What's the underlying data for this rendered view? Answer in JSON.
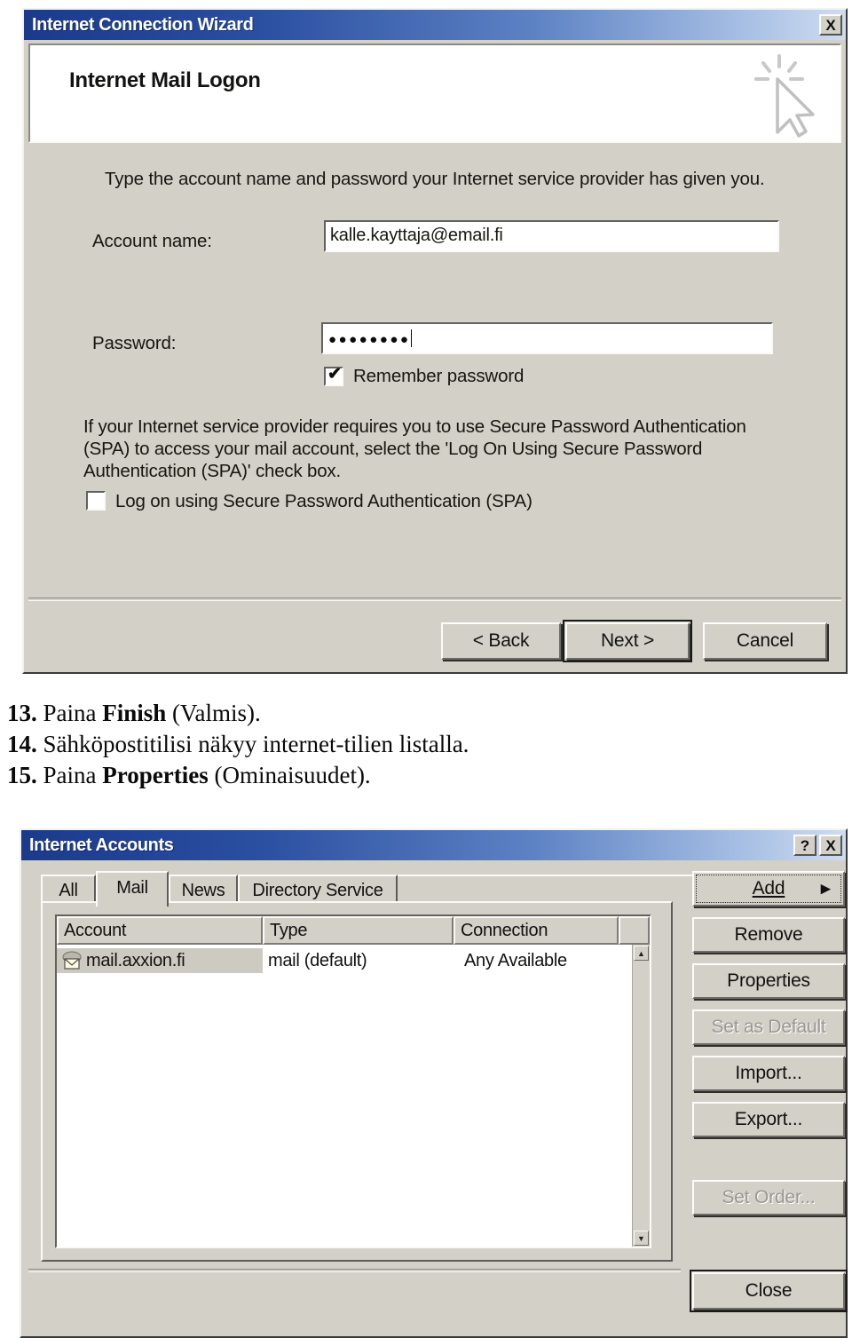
{
  "wizard": {
    "window_title": "Internet Connection Wizard",
    "close_button": "X",
    "heading": "Internet Mail Logon",
    "cursor_icon": "mouse-click-cursor-icon",
    "intro": "Type the account name and password your Internet service provider has given you.",
    "account_label": "Account name:",
    "account_value": "kalle.kayttaja@email.fi",
    "account_placeholder": "",
    "password_label": "Password:",
    "password_value": "●●●●●●●●",
    "password_placeholder": "",
    "remember_label": "Remember password",
    "remember_checked": true,
    "remember_tick": "✔",
    "spa_paragraph": "If your Internet service provider requires you to use Secure Password Authentication (SPA) to access your mail account, select the 'Log On Using Secure Password Authentication (SPA)' check box.",
    "spa_label": "Log on using Secure Password Authentication (SPA)",
    "spa_checked": false,
    "buttons": {
      "back": "< Back",
      "next": "Next >",
      "cancel": "Cancel"
    }
  },
  "steps": [
    {
      "number": "13.",
      "pre": "Paina ",
      "bold": "Finish",
      "post": " (Valmis)."
    },
    {
      "number": "14.",
      "pre": "Sähköpostitilisi näkyy internet-tilien listalla.",
      "bold": "",
      "post": ""
    },
    {
      "number": "15.",
      "pre": "Paina ",
      "bold": "Properties",
      "post": " (Ominaisuudet)."
    }
  ],
  "accounts": {
    "window_title": "Internet Accounts",
    "help_button": "?",
    "close_button": "X",
    "tabs": [
      {
        "label": "All",
        "selected": false
      },
      {
        "label": "Mail",
        "selected": true
      },
      {
        "label": "News",
        "selected": false
      },
      {
        "label": "Directory Service",
        "selected": false
      }
    ],
    "columns": [
      "Account",
      "Type",
      "Connection"
    ],
    "rows": [
      {
        "icon": "mail-account-icon",
        "account": "mail.axxion.fi",
        "type": "mail (default)",
        "connection": "Any Available",
        "selected": true
      }
    ],
    "scrollbar": {
      "up": "▲",
      "down": "▼"
    },
    "buttons": [
      {
        "label": "Add",
        "accel": "A",
        "arrow": "▶",
        "enabled": true,
        "focused": true
      },
      {
        "label": "Remove",
        "accel": "",
        "arrow": "",
        "enabled": true,
        "focused": false
      },
      {
        "label": "Properties",
        "accel": "",
        "arrow": "",
        "enabled": true,
        "focused": false
      },
      {
        "label": "Set as Default",
        "accel": "",
        "arrow": "",
        "enabled": false,
        "focused": false
      },
      {
        "label": "Import...",
        "accel": "",
        "arrow": "",
        "enabled": true,
        "focused": false
      },
      {
        "label": "Export...",
        "accel": "",
        "arrow": "",
        "enabled": true,
        "focused": false
      },
      {
        "label": "Set Order...",
        "accel": "",
        "arrow": "",
        "enabled": false,
        "focused": false
      }
    ],
    "close_label": "Close"
  },
  "colors": {
    "titlebar_start": "#1b3a8c",
    "titlebar_end": "#cfdcf0",
    "dialog_face": "#d3d0c8",
    "field_bg": "#ffffff",
    "text": "#17160f",
    "disabled_text": "#9a9792",
    "selection_bg": "#cdcac2"
  }
}
